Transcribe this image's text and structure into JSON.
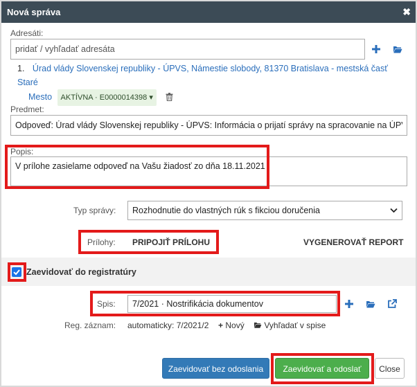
{
  "dialog": {
    "title": "Nová správa"
  },
  "recipients": {
    "label": "Adresáti:",
    "placeholder": "pridať / vyhľadať adresáta",
    "item_number": "1.",
    "item_text_line1": "Úrad vlády Slovenskej republiky - ÚPVS, Námestie slobody, 81370 Bratislava - mestská časť Staré",
    "item_text_line2": "Mesto",
    "status_badge": "AKTÍVNA · E0000014398 ▾"
  },
  "subject": {
    "label": "Predmet:",
    "value": "Odpoveď: Úrad vlády Slovenskej republiky - ÚPVS: Informácia o prijatí správy na spracovanie na ÚPVS"
  },
  "description": {
    "label": "Popis:",
    "value": "V prílohe zasielame odpoveď na Vašu žiadosť zo dňa 18.11.2021"
  },
  "message_type": {
    "label": "Typ správy:",
    "value": "Rozhodnutie do vlastných rúk s fikciou doručenia"
  },
  "attachments": {
    "label": "Prílohy:",
    "attach_button": "PRIPOJIŤ PRÍLOHU",
    "generate_button": "VYGENEROVAŤ REPORT"
  },
  "registry": {
    "checkbox_label": "Zaevidovať do registratúry",
    "checked": true,
    "file_label": "Spis:",
    "file_value": "7/2021 · Nostrifikácia dokumentov",
    "reg_label": "Reg. záznam:",
    "reg_value": "automaticky: 7/2021/2",
    "new_label": "Nový",
    "search_label": "Vyhľadať v spise"
  },
  "footer": {
    "record_no_send": "Zaevidovať bez odoslania",
    "record_send": "Zaevidovať a odoslať",
    "close": "Close"
  },
  "colors": {
    "titlebar": "#3c4b56",
    "link": "#2a6ebb",
    "primary": "#337ab7",
    "success": "#4cae4c",
    "highlight": "#e31a1a"
  }
}
